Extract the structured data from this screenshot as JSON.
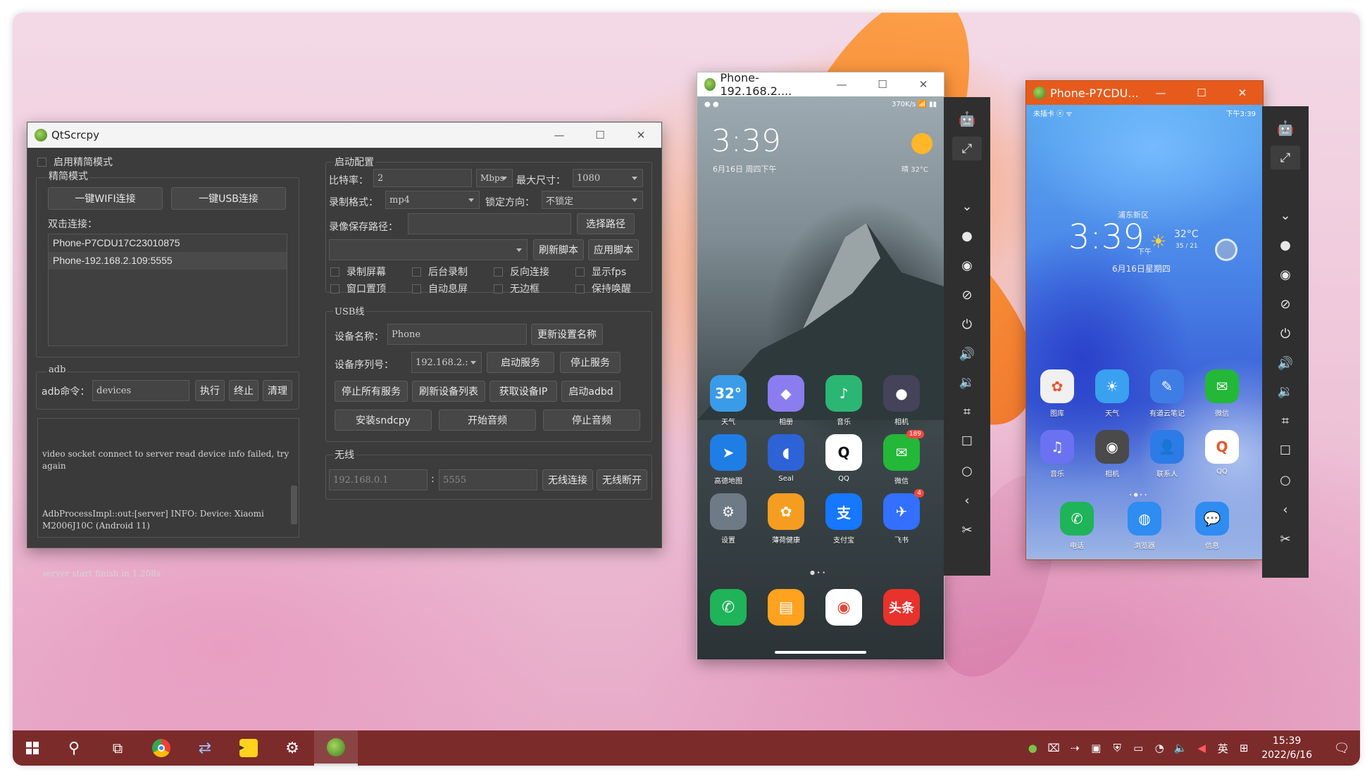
{
  "qtscrcpy": {
    "title": "QtScrcpy",
    "simple_mode_checkbox": "启用精简模式",
    "simple_mode_group": "精简模式",
    "wifi_connect": "一键WIFI连接",
    "usb_connect": "一键USB连接",
    "double_click_connect": "双击连接：",
    "devices": [
      "Phone-P7CDU17C23010875",
      "Phone-192.168.2.109:5555"
    ],
    "adb_group": "adb",
    "adb_cmd_label": "adb命令：",
    "adb_cmd_value": "devices",
    "execute": "执行",
    "terminate": "终止",
    "clear": "清理",
    "log": [
      "video socket connect to server read device info failed, try again",
      "AdbProcessImpl::out:[server] INFO: Device: Xiaomi M2006J10C (Android 11)",
      "server start finish in 1.208s"
    ],
    "launch_config": "启动配置",
    "bitrate_label": "比特率：",
    "bitrate_value": "2",
    "bitrate_unit": "Mbps",
    "max_size_label": "最大尺寸：",
    "max_size_value": "1080",
    "record_format_label": "录制格式：",
    "record_format_value": "mp4",
    "lock_orientation_label": "锁定方向：",
    "lock_orientation_value": "不锁定",
    "record_path_label": "录像保存路径：",
    "select_path": "选择路径",
    "refresh_script": "刷新脚本",
    "apply_script": "应用脚本",
    "checkboxes": [
      "录制屏幕",
      "后台录制",
      "反向连接",
      "显示fps",
      "窗口置顶",
      "自动息屏",
      "无边框",
      "保持唤醒"
    ],
    "usb_group": "USB线",
    "device_name_label": "设备名称：",
    "device_name_value": "Phone",
    "update_name": "更新设置名称",
    "device_serial_label": "设备序列号：",
    "device_serial_value": "192.168.2.:",
    "start_service": "启动服务",
    "stop_service": "停止服务",
    "stop_all_services": "停止所有服务",
    "refresh_devices": "刷新设备列表",
    "get_device_ip": "获取设备IP",
    "start_adbd": "启动adbd",
    "install_sndcpy": "安装sndcpy",
    "start_audio": "开始音频",
    "stop_audio": "停止音频",
    "wireless_group": "无线",
    "ip_placeholder": "192.168.0.1",
    "port_placeholder": "5555",
    "ip_port_separator": ":",
    "wireless_connect": "无线连接",
    "wireless_disconnect": "无线断开"
  },
  "phone1": {
    "title": "Phone-192.168.2....",
    "status_right": "370K/s 📶 ▮▮",
    "time": "3:39",
    "date": "6月16日 周四下午",
    "weather_temp": "晴 32°C",
    "apps": [
      {
        "name": "天气",
        "glyph": "32°",
        "color": "#3a9be8"
      },
      {
        "name": "相册",
        "glyph": "◆",
        "color": "#8b7cf0"
      },
      {
        "name": "音乐",
        "glyph": "♪",
        "color": "#2bb673"
      },
      {
        "name": "相机",
        "glyph": "●",
        "color": "#44435a"
      },
      {
        "name": "高德地图",
        "glyph": "➤",
        "color": "#1f7de6"
      },
      {
        "name": "Seal",
        "glyph": "◖",
        "color": "#2d63d6"
      },
      {
        "name": "QQ",
        "glyph": "Q",
        "color": "#ffffff"
      },
      {
        "name": "微信",
        "glyph": "✉",
        "color": "#23b838"
      },
      {
        "name": "设置",
        "glyph": "⚙",
        "color": "#6e7a86"
      },
      {
        "name": "薄荷健康",
        "glyph": "✿",
        "color": "#f59d20"
      },
      {
        "name": "支付宝",
        "glyph": "支",
        "color": "#1677ff"
      },
      {
        "name": "飞书",
        "glyph": "✈",
        "color": "#3370ff"
      }
    ],
    "wechat_badge": "189",
    "feishu_badge": "4",
    "dock": [
      {
        "glyph": "✆",
        "color": "#1fb35a"
      },
      {
        "glyph": "▤",
        "color": "#ffa21f"
      },
      {
        "glyph": "◉",
        "color": "#ffffff"
      },
      {
        "glyph": "头条",
        "color": "#e8322c"
      }
    ]
  },
  "phone2": {
    "title": "Phone-P7CDU...",
    "status_left": "未插卡 ⓔ ᯤ",
    "status_right": "下午3:39",
    "location": "浦东新区",
    "time": "3:39",
    "time_suffix": "下午",
    "weather_temp": "32°C",
    "weather_range": "35 / 21",
    "date": "6月16日星期四",
    "apps": [
      {
        "name": "图库",
        "glyph": "✿",
        "color": "#f0f0f0"
      },
      {
        "name": "天气",
        "glyph": "☀",
        "color": "#3aa0f0"
      },
      {
        "name": "有道云笔记",
        "glyph": "✎",
        "color": "#3f7de6"
      },
      {
        "name": "微信",
        "glyph": "✉",
        "color": "#23b838"
      },
      {
        "name": "音乐",
        "glyph": "♫",
        "color": "#6b72f2"
      },
      {
        "name": "相机",
        "glyph": "◉",
        "color": "#4a4a4a"
      },
      {
        "name": "联系人",
        "glyph": "👤",
        "color": "#2d7be6"
      },
      {
        "name": "QQ",
        "glyph": "Q",
        "color": "#ffffff"
      }
    ],
    "dock": [
      {
        "name": "电话",
        "glyph": "✆",
        "color": "#1fb35a"
      },
      {
        "name": "浏览器",
        "glyph": "◍",
        "color": "#2f8cf0"
      },
      {
        "name": "信息",
        "glyph": "💬",
        "color": "#2f8cf0"
      }
    ]
  },
  "toolbar_icons": [
    "android-icon",
    "fullscreen-icon",
    "collapse-icon",
    "touch-icon",
    "show-icon",
    "hide-icon",
    "power-icon",
    "volume-up-icon",
    "volume-down-icon",
    "rotate-icon",
    "app-switch-icon",
    "home-icon",
    "back-icon",
    "screenshot-icon"
  ],
  "taskbar": {
    "time": "15:39",
    "date": "2022/6/16",
    "ime": "英"
  },
  "colors": {
    "taskbar": "#7c2b2b",
    "qt_bg": "#3c3c3c"
  }
}
